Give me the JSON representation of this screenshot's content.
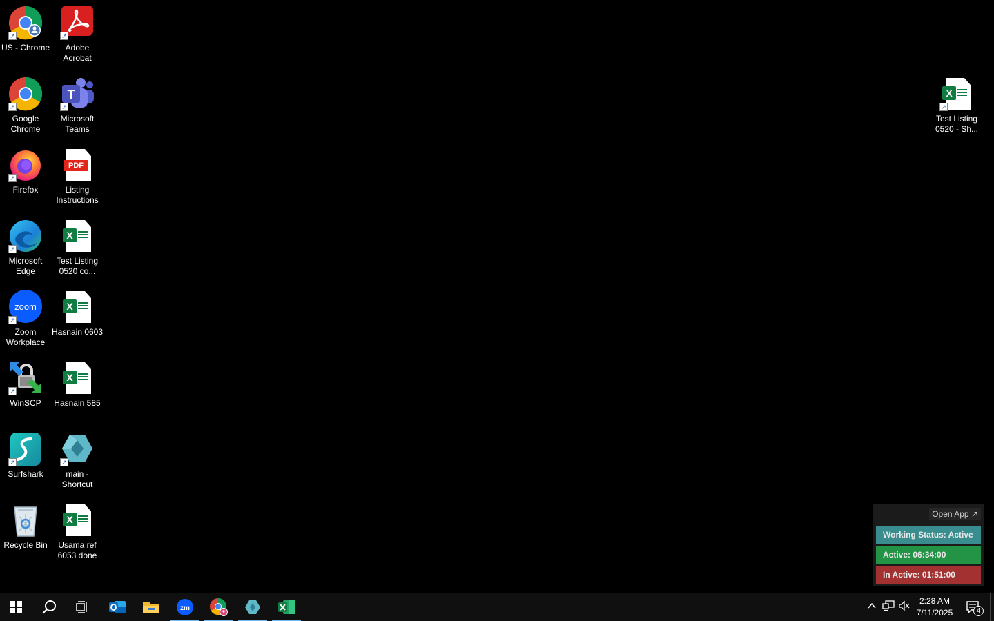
{
  "desktop": {
    "icons": [
      {
        "label": "US - Chrome"
      },
      {
        "label": "Adobe Acrobat"
      },
      {
        "label": "Google Chrome"
      },
      {
        "label": "Microsoft Teams"
      },
      {
        "label": "Firefox"
      },
      {
        "label": "Listing Instructions"
      },
      {
        "label": "Microsoft Edge"
      },
      {
        "label": "Test Listing 0520 co..."
      },
      {
        "label": "Zoom Workplace"
      },
      {
        "label": "Hasnain 0603"
      },
      {
        "label": "WinSCP"
      },
      {
        "label": "Hasnain 585"
      },
      {
        "label": "Surfshark"
      },
      {
        "label": "main - Shortcut"
      },
      {
        "label": "Recycle Bin"
      },
      {
        "label": "Usama ref 6053 done"
      },
      {
        "label": "Test Listing 0520 - Sh..."
      }
    ],
    "pdf_badge": "PDF",
    "teams_letter": "T",
    "zoom_text": "zoom",
    "excel_letter": "X"
  },
  "widget": {
    "open_app": "Open App ↗",
    "working_status": "Working Status: Active",
    "active": "Active: 06:34:00",
    "inactive": "In Active: 01:51:00",
    "colors": {
      "working": "#3a8d8f",
      "active": "#239446",
      "inactive": "#a33131"
    }
  },
  "taskbar": {
    "zoom_text": "zm",
    "time": "2:28 AM",
    "date": "7/11/2025",
    "notification_count": "4"
  }
}
